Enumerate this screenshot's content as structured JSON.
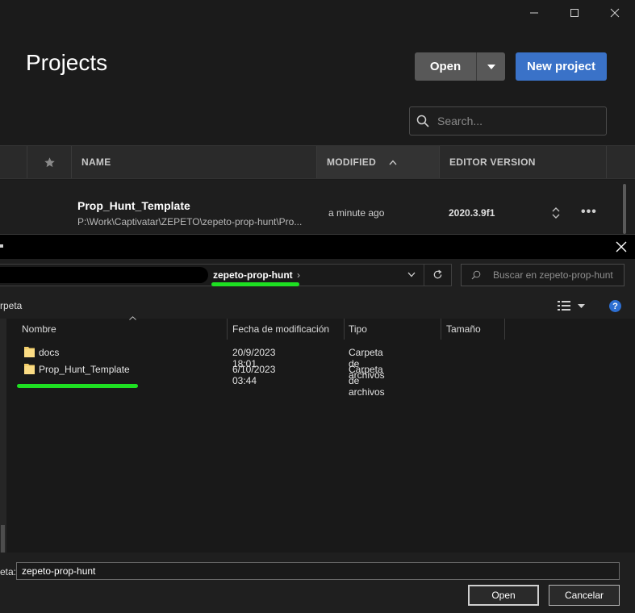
{
  "hub": {
    "title": "Projects",
    "open_label": "Open",
    "new_project_label": "New project",
    "search_placeholder": "Search...",
    "columns": {
      "name": "NAME",
      "modified": "MODIFIED",
      "editor_version": "EDITOR VERSION"
    },
    "project": {
      "name": "Prop_Hunt_Template",
      "path": "P:\\Work\\Captivatar\\ZEPETO\\zepeto-prop-hunt\\Pro...",
      "modified": "a minute ago",
      "version": "2020.3.9f1",
      "more": "•••"
    }
  },
  "dialog": {
    "address_current": "zepeto-prop-hunt",
    "address_sep": "›",
    "search_placeholder": "Buscar en zepeto-prop-hunt",
    "toolbar_label": "rpeta",
    "help": "?",
    "columns": {
      "name": "Nombre",
      "date": "Fecha de modificación",
      "type": "Tipo",
      "size": "Tamaño"
    },
    "rows": [
      {
        "name": "docs",
        "date": "20/9/2023 18:01",
        "type": "Carpeta de archivos"
      },
      {
        "name": "Prop_Hunt_Template",
        "date": "6/10/2023 03:44",
        "type": "Carpeta de archivos"
      }
    ],
    "filename_label": "eta:",
    "filename_value": "zepeto-prop-hunt",
    "open_label": "Open",
    "cancel_label": "Cancelar"
  },
  "colors": {
    "accent_blue": "#3a72c8",
    "highlight_green": "#1ee022",
    "background": "#1b1b1b"
  }
}
